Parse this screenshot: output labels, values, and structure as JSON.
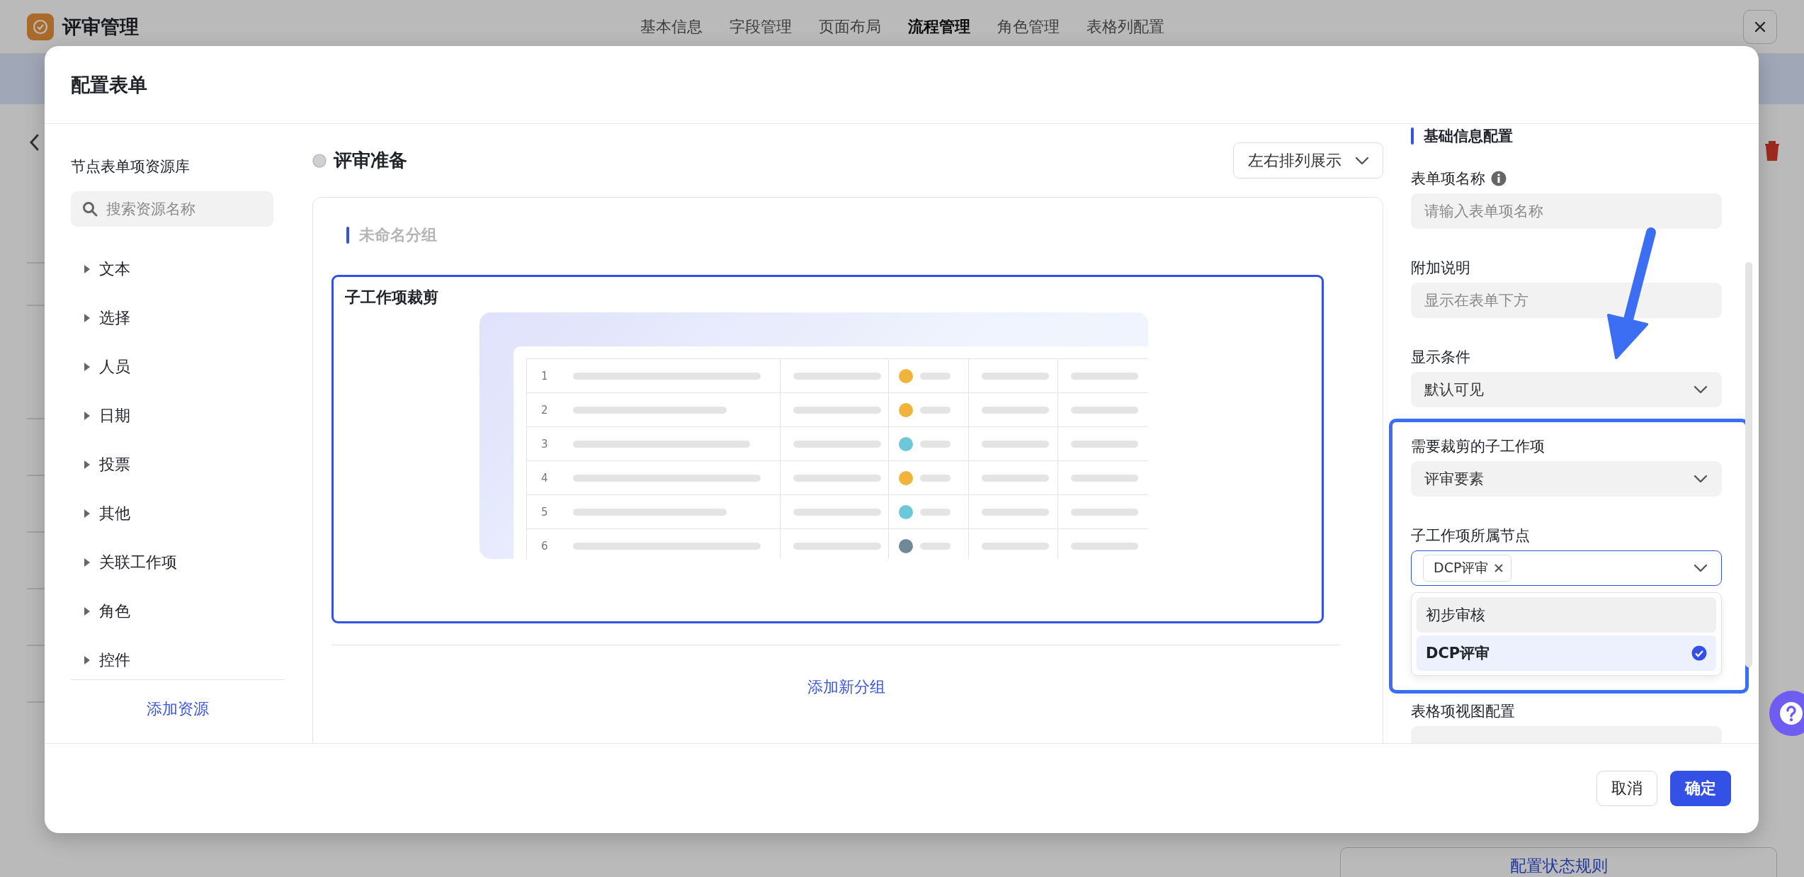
{
  "app": {
    "title": "评审管理",
    "tabs": [
      {
        "label": "基本信息",
        "selected": false
      },
      {
        "label": "字段管理",
        "selected": false
      },
      {
        "label": "页面布局",
        "selected": false
      },
      {
        "label": "流程管理",
        "selected": true
      },
      {
        "label": "角色管理",
        "selected": false
      },
      {
        "label": "表格列配置",
        "selected": false
      }
    ]
  },
  "background": {
    "rule_button": "配置状态规则"
  },
  "modal": {
    "title": "配置表单",
    "cancel": "取消",
    "confirm": "确定"
  },
  "resources": {
    "title": "节点表单项资源库",
    "search_placeholder": "搜索资源名称",
    "items": [
      {
        "label": "文本",
        "expanded": false
      },
      {
        "label": "选择",
        "expanded": false
      },
      {
        "label": "人员",
        "expanded": false
      },
      {
        "label": "日期",
        "expanded": false
      },
      {
        "label": "投票",
        "expanded": false
      },
      {
        "label": "其他",
        "expanded": false
      },
      {
        "label": "关联工作项",
        "expanded": false
      },
      {
        "label": "角色",
        "expanded": false
      },
      {
        "label": "控件",
        "expanded": false
      }
    ],
    "add_link": "添加资源"
  },
  "canvas": {
    "node": "评审准备",
    "layout_select": "左右排列展示",
    "group_title": "未命名分组",
    "form_item": {
      "label": "子工作项裁剪",
      "selected": true
    },
    "preview_rows": [
      {
        "index": "1",
        "color": "#f0b43c"
      },
      {
        "index": "2",
        "color": "#f0b43c"
      },
      {
        "index": "3",
        "color": "#6cc7d8"
      },
      {
        "index": "4",
        "color": "#f0b43c"
      },
      {
        "index": "5",
        "color": "#6cc7d8"
      },
      {
        "index": "6",
        "color": "#6f8a96"
      }
    ],
    "add_group": "添加新分组"
  },
  "properties": {
    "section_title": "基础信息配置",
    "fields": [
      {
        "kind": "input",
        "label": "表单项名称",
        "info": true,
        "placeholder": "请输入表单项名称"
      },
      {
        "kind": "input",
        "label": "附加说明",
        "placeholder": "显示在表单下方"
      },
      {
        "kind": "select",
        "label": "显示条件",
        "value": "默认可见"
      },
      {
        "kind": "select",
        "label": "需要裁剪的子工作项",
        "value": "评审要素"
      },
      {
        "kind": "multiselect",
        "label": "子工作项所属节点",
        "tags": [
          "DCP评审"
        ],
        "open": true,
        "options": [
          {
            "label": "初步审核",
            "selected": false,
            "hovered": true
          },
          {
            "label": "DCP评审",
            "selected": true,
            "hovered": false
          }
        ]
      },
      {
        "kind": "input",
        "label": "表格项视图配置"
      }
    ]
  }
}
